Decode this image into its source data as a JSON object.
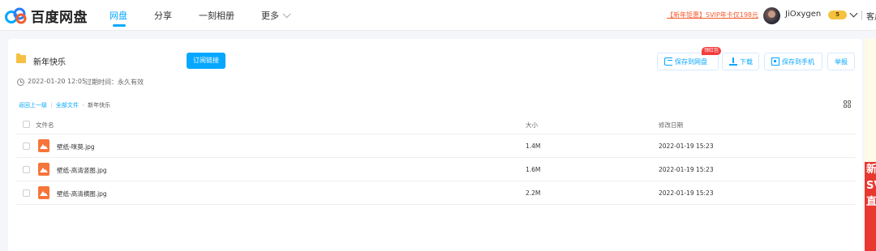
{
  "header": {
    "logo_text": "百度网盘",
    "nav": [
      {
        "label": "网盘"
      },
      {
        "label": "分享"
      },
      {
        "label": "一刻相册"
      },
      {
        "label": "更多"
      }
    ],
    "promo_text": "【新年钜惠】SVIP年卡仅198元",
    "username": "JiOxygen",
    "vip_badge": "5",
    "client_link": "客户端"
  },
  "share": {
    "folder_name": "新年快乐",
    "subscribe_label": "订阅链接",
    "created_at": "2022-01-20 12:05",
    "expire_text": "过期时间：永久有效",
    "actions": {
      "save_label": "保存到网盘",
      "save_badge": "领红包",
      "download_label": "下载",
      "save_phone_label": "保存到手机",
      "report_label": "举报"
    },
    "breadcrumb": {
      "back": "返回上一级",
      "all": "全部文件",
      "current": "新年快乐"
    },
    "columns": {
      "name": "文件名",
      "size": "大小",
      "date": "修改日期"
    },
    "files": [
      {
        "name": "壁纸-咪莫.jpg",
        "size": "1.4M",
        "date": "2022-01-19 15:23"
      },
      {
        "name": "壁纸-高清竖图.jpg",
        "size": "1.6M",
        "date": "2022-01-19 15:23"
      },
      {
        "name": "壁纸-高清横图.jpg",
        "size": "2.2M",
        "date": "2022-01-19 15:23"
      }
    ]
  },
  "side_promo": "新SV直",
  "colors": {
    "accent": "#06a7ff",
    "promo": "#f25c2e",
    "folder": "#f6c044",
    "image_icon": "#f7743a"
  }
}
